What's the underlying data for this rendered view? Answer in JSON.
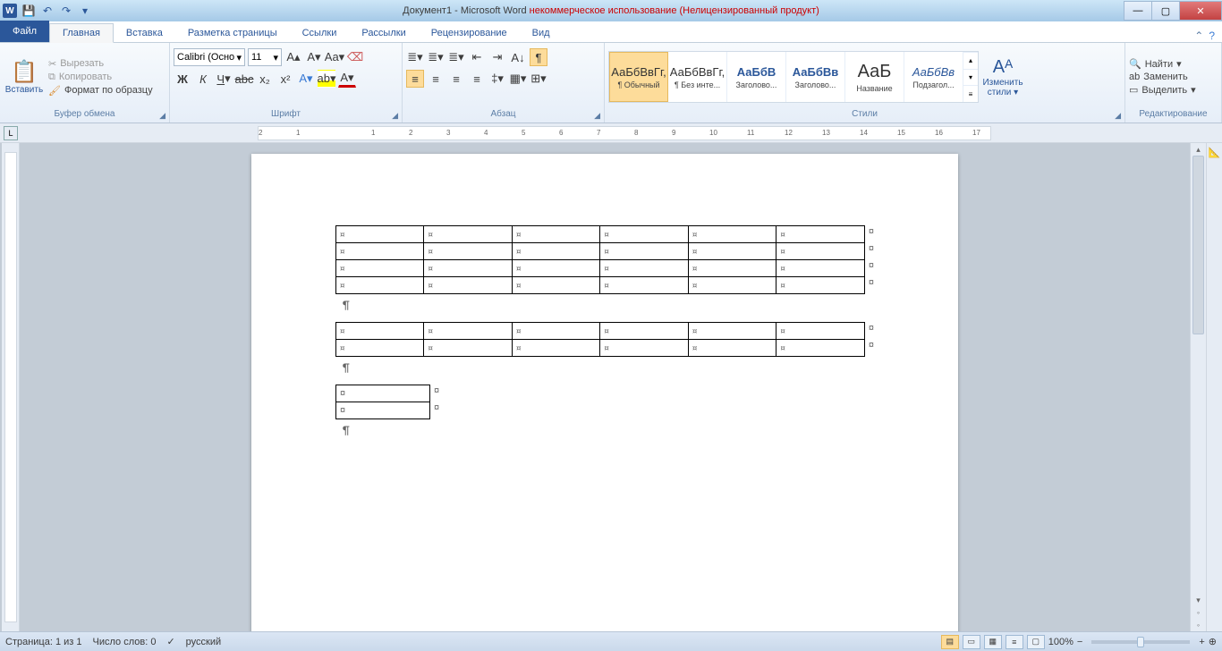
{
  "title": {
    "doc": "Документ1",
    "app": " -  Microsoft Word",
    "suffix1": " некоммерческое использование",
    "suffix2": " (Нелицензированный продукт)"
  },
  "tabs": {
    "file": "Файл",
    "items": [
      "Главная",
      "Вставка",
      "Разметка страницы",
      "Ссылки",
      "Рассылки",
      "Рецензирование",
      "Вид"
    ],
    "active": 0
  },
  "clipboard": {
    "paste": "Вставить",
    "cut": "Вырезать",
    "copy": "Копировать",
    "fmt": "Формат по образцу",
    "label": "Буфер обмена"
  },
  "font": {
    "name": "Calibri (Осно",
    "size": "11",
    "label": "Шрифт"
  },
  "para": {
    "label": "Абзац"
  },
  "styles": {
    "label": "Стили",
    "change": "Изменить стили",
    "items": [
      {
        "prev": "АаБбВвГг,",
        "name": "¶ Обычный",
        "sel": true
      },
      {
        "prev": "АаБбВвГг,",
        "name": "¶ Без инте..."
      },
      {
        "prev": "АаБбВ",
        "name": "Заголово...",
        "color": "#2b579a",
        "bold": true
      },
      {
        "prev": "АаБбВв",
        "name": "Заголово...",
        "color": "#2b579a",
        "bold": true
      },
      {
        "prev": "АаБ",
        "name": "Название",
        "size": "20px"
      },
      {
        "prev": "АаБбВв",
        "name": "Подзагол...",
        "color": "#2b579a",
        "italic": true
      }
    ]
  },
  "editing": {
    "find": "Найти",
    "replace": "Заменить",
    "select": "Выделить",
    "label": "Редактирование"
  },
  "ruler": {
    "marks": [
      "2",
      "1",
      "",
      "1",
      "2",
      "3",
      "4",
      "5",
      "6",
      "7",
      "8",
      "9",
      "10",
      "11",
      "12",
      "13",
      "14",
      "15",
      "16",
      "17"
    ]
  },
  "doc": {
    "cellmark": "¤",
    "paramark": "¶",
    "table1": {
      "rows": 4,
      "cols": 6
    },
    "table2": {
      "rows": 2,
      "cols": 6
    },
    "table3": {
      "rows": 2,
      "cols": 1
    }
  },
  "status": {
    "page": "Страница: 1 из 1",
    "words": "Число слов: 0",
    "lang": "русский",
    "zoom": "100%"
  }
}
